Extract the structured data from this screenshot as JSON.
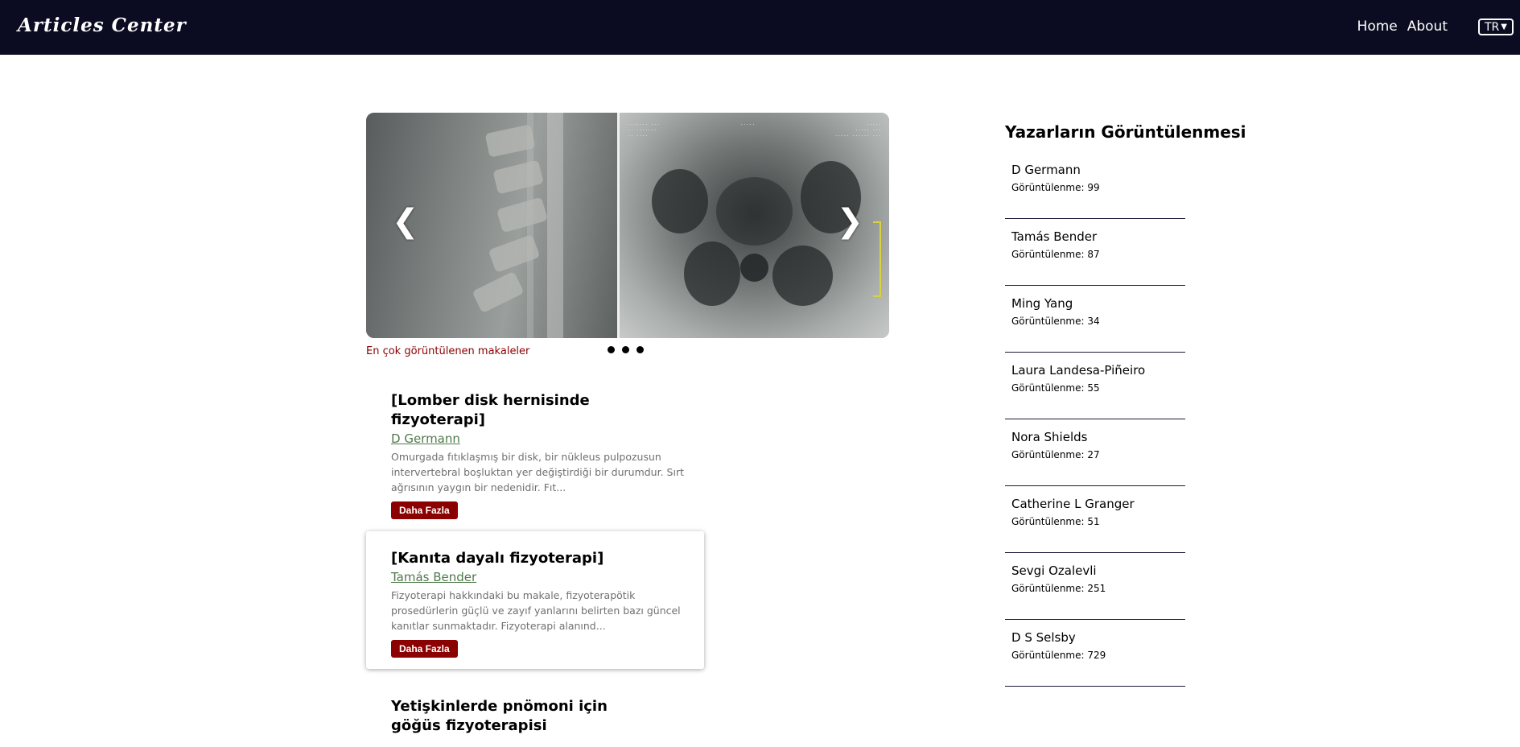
{
  "header": {
    "brand": "Articles Center",
    "nav": [
      {
        "label": "Home"
      },
      {
        "label": "About"
      }
    ],
    "language": "TR"
  },
  "carousel": {
    "caption": "En çok görüntülenen makaleler",
    "prev_icon": "chevron-left-icon",
    "next_icon": "chevron-right-icon",
    "slide_count": 3
  },
  "articles": [
    {
      "title": "[Lomber disk hernisinde fizyoterapi]",
      "author": "D Germann",
      "excerpt": "Omurgada fıtıklaşmış bir disk, bir nükleus pulpozusun intervertebral boşluktan yer değiştirdiği bir durumdur. Sırt ağrısının yaygın bir nedenidir. Fıt...",
      "button": "Daha Fazla"
    },
    {
      "title": "[Kanıta dayalı fizyoterapi]",
      "author": "Tamás Bender",
      "excerpt": "Fizyoterapi hakkındaki bu makale, fizyoterapötik prosedürlerin güçlü ve zayıf yanlarını belirten bazı güncel kanıtlar sunmaktadır. Fizyoterapi alanınd...",
      "button": "Daha Fazla"
    },
    {
      "title": "Yetişkinlerde pnömoni için göğüs fizyoterapisi"
    }
  ],
  "authors": {
    "title": "Yazarların Görüntülenmesi",
    "items": [
      {
        "name": "D Germann",
        "views": "Görüntülenme: 99"
      },
      {
        "name": "Tamás Bender",
        "views": "Görüntülenme: 87"
      },
      {
        "name": "Ming Yang",
        "views": "Görüntülenme: 34"
      },
      {
        "name": "Laura Landesa-Piñeiro",
        "views": "Görüntülenme: 55"
      },
      {
        "name": "Nora Shields",
        "views": "Görüntülenme: 27"
      },
      {
        "name": "Catherine L Granger",
        "views": "Görüntülenme: 51"
      },
      {
        "name": "Sevgi Ozalevli",
        "views": "Görüntülenme: 251"
      },
      {
        "name": "D S Selsby",
        "views": "Görüntülenme: 729"
      }
    ]
  }
}
